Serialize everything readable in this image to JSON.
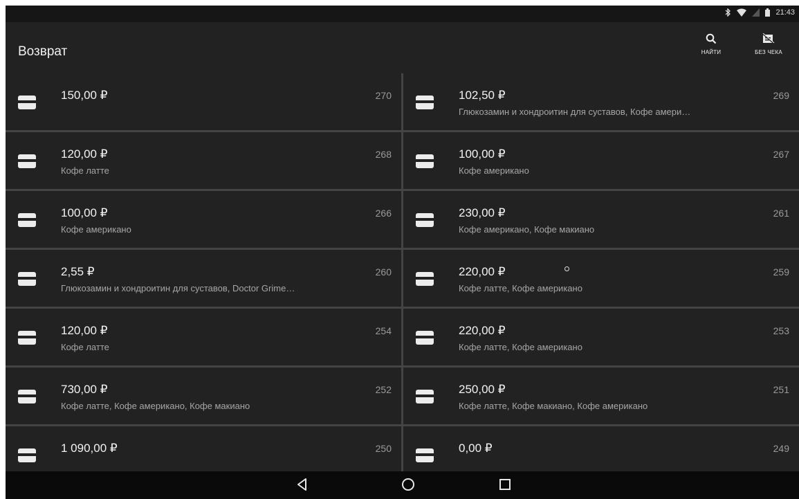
{
  "status": {
    "time": "21:43"
  },
  "appbar": {
    "title": "Возврат",
    "search_label": "НАЙТИ",
    "nocheck_label": "БЕЗ ЧЕКА"
  },
  "receipts": [
    {
      "amount": "150,00 ₽",
      "number": "270",
      "desc": ""
    },
    {
      "amount": "102,50 ₽",
      "number": "269",
      "desc": "Глюкозамин и хондроитин для суставов, Кофе амери…"
    },
    {
      "amount": "120,00 ₽",
      "number": "268",
      "desc": "Кофе латте"
    },
    {
      "amount": "100,00 ₽",
      "number": "267",
      "desc": "Кофе американо"
    },
    {
      "amount": "100,00 ₽",
      "number": "266",
      "desc": "Кофе американо"
    },
    {
      "amount": "230,00 ₽",
      "number": "261",
      "desc": "Кофе американо, Кофе макиано"
    },
    {
      "amount": "2,55 ₽",
      "number": "260",
      "desc": "Глюкозамин и хондроитин для суставов, Doctor Grime…"
    },
    {
      "amount": "220,00 ₽",
      "number": "259",
      "desc": "Кофе латте, Кофе американо"
    },
    {
      "amount": "120,00 ₽",
      "number": "254",
      "desc": "Кофе латте"
    },
    {
      "amount": "220,00 ₽",
      "number": "253",
      "desc": "Кофе латте, Кофе американо"
    },
    {
      "amount": "730,00 ₽",
      "number": "252",
      "desc": "Кофе латте, Кофе американо, Кофе макиано"
    },
    {
      "amount": "250,00 ₽",
      "number": "251",
      "desc": "Кофе латте, Кофе макиано, Кофе американо"
    },
    {
      "amount": "1 090,00 ₽",
      "number": "250",
      "desc": ""
    },
    {
      "amount": "0,00 ₽",
      "number": "249",
      "desc": ""
    }
  ],
  "icons": {
    "bluetooth": "bluetooth-icon",
    "wifi": "wifi-icon",
    "signal": "signal-icon",
    "battery": "battery-icon",
    "search": "search-icon",
    "no_receipt": "no-receipt-icon",
    "card": "card-icon",
    "back": "back-icon",
    "home": "home-icon",
    "recents": "recents-icon"
  },
  "colors": {
    "background": "#222222",
    "divider": "#444444",
    "text_primary": "#f2f2f2",
    "text_secondary": "#a6a6a6"
  }
}
